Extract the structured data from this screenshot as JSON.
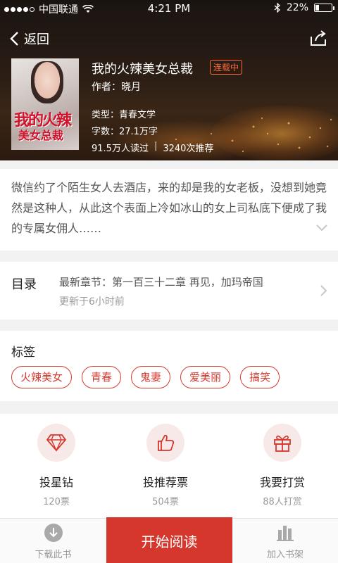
{
  "status_bar": {
    "carrier": "中国联通",
    "time": "4:21 PM",
    "battery_text": "22%",
    "battery_level": 0.22
  },
  "nav": {
    "back_label": "返回"
  },
  "book": {
    "title": "我的火辣美女总裁",
    "status_badge": "连载中",
    "author_line": "作者：晓月",
    "genre_line": "类型：青春文学",
    "words_line": "字数：27.1万字",
    "readers": "91.5万人读过",
    "stats_separator": "|",
    "recommends": "3240次推荐",
    "cover_text_line1": "我的火辣",
    "cover_text_line2": "美女总裁"
  },
  "synopsis": {
    "text": "微信约了个陌生女人去酒店，来的却是我的女老板，没想到她竟然是这种人，从此这个表面上冷如冰山的女上司私底下便成了我的专属女佣人……"
  },
  "toc": {
    "label": "目录",
    "latest_chapter": "最新章节：第一百三十二章 再见，加玛帝国",
    "updated": "更新于6小时前"
  },
  "tags": {
    "label": "标签",
    "items": [
      "火辣美女",
      "青春",
      "鬼妻",
      "爱美丽",
      "搞笑"
    ]
  },
  "actions": [
    {
      "name": "投星钻",
      "sub": "120票",
      "icon": "diamond-icon"
    },
    {
      "name": "投推荐票",
      "sub": "504票",
      "icon": "thumbs-up-icon"
    },
    {
      "name": "我要打赏",
      "sub": "88人打赏",
      "icon": "gift-icon"
    }
  ],
  "bottom_bar": {
    "download_label": "下载此书",
    "start_label": "开始阅读",
    "shelf_label": "加入书架"
  },
  "colors": {
    "accent": "#d6372d",
    "badge": "#ff6a3c"
  }
}
